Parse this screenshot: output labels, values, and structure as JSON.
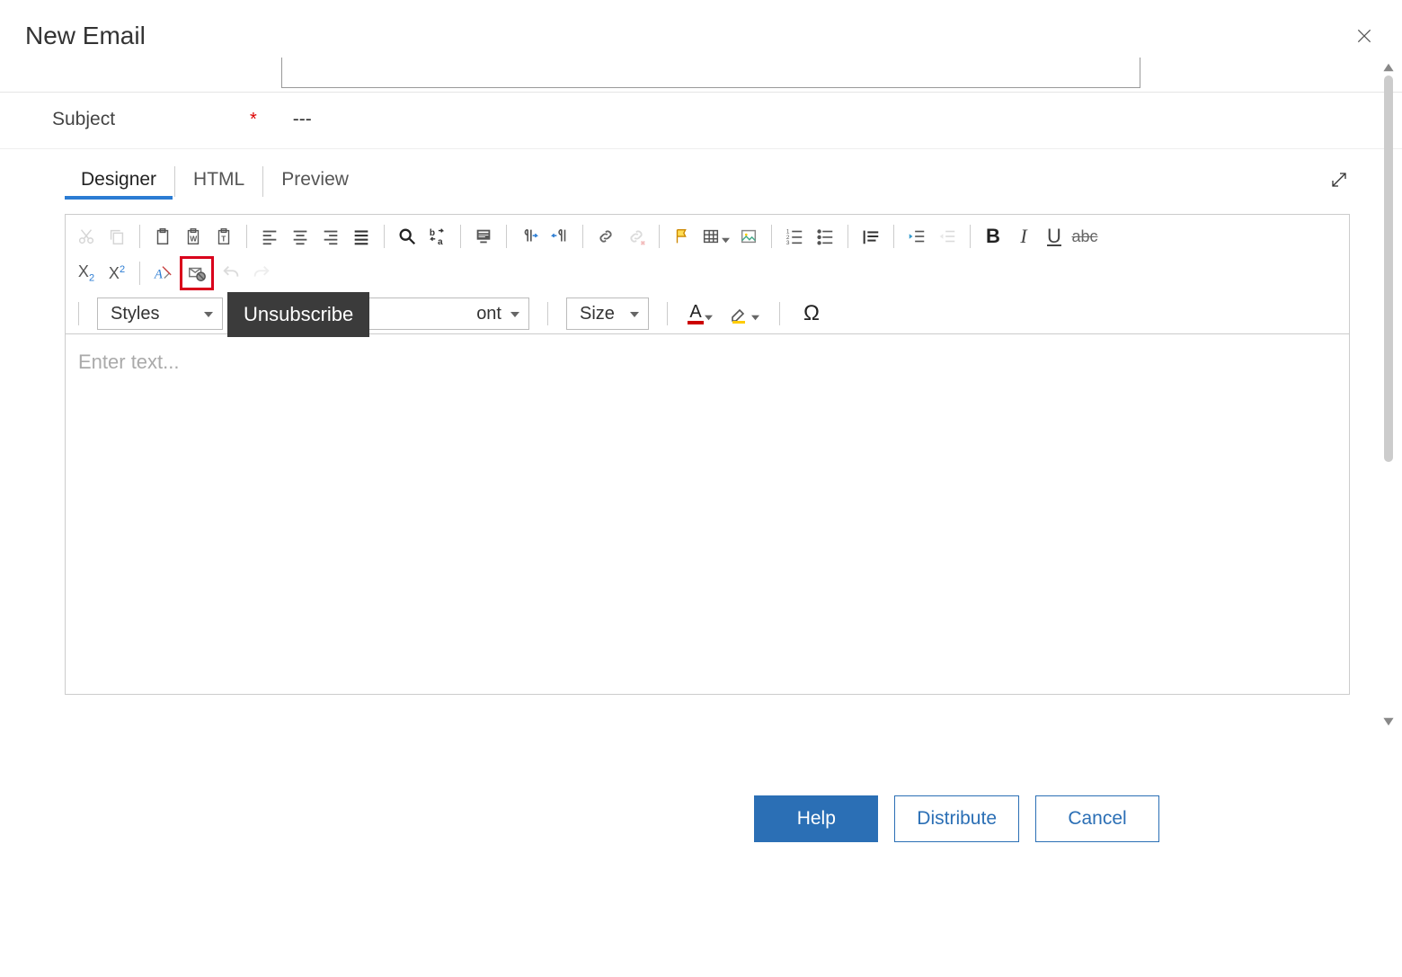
{
  "title": "New Email",
  "subject": {
    "label": "Subject",
    "required": "*",
    "value": "---"
  },
  "tabs": {
    "designer": "Designer",
    "html": "HTML",
    "preview": "Preview"
  },
  "toolbar": {
    "styles": "Styles",
    "font_fragment": "ont",
    "size": "Size",
    "tooltip": "Unsubscribe"
  },
  "editor": {
    "placeholder": "Enter text..."
  },
  "buttons": {
    "help": "Help",
    "distribute": "Distribute",
    "cancel": "Cancel"
  }
}
